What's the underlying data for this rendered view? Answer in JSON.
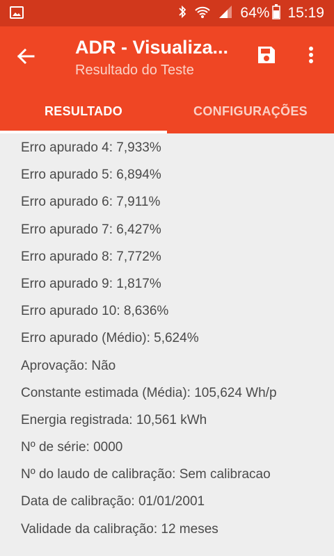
{
  "status_bar": {
    "battery_percent": "64%",
    "time": "15:19",
    "icons": [
      "image-icon",
      "bluetooth-icon",
      "wifi-icon",
      "signal-icon",
      "battery-icon"
    ]
  },
  "toolbar": {
    "title": "ADR - Visualiza...",
    "subtitle": "Resultado do Teste",
    "icons": [
      "back-arrow-icon",
      "save-icon",
      "more-vert-icon"
    ]
  },
  "tabs": [
    {
      "label": "RESULTADO",
      "active": true
    },
    {
      "label": "CONFIGURAÇÕES",
      "active": false
    }
  ],
  "results": [
    "Erro apurado 4: 7,933%",
    "Erro apurado 5: 6,894%",
    "Erro apurado 6: 7,911%",
    "Erro apurado 7: 6,427%",
    "Erro apurado 8: 7,772%",
    "Erro apurado 9: 1,817%",
    "Erro apurado 10: 8,636%",
    "Erro apurado (Médio): 5,624%",
    "Aprovação: Não",
    "Constante estimada (Média): 105,624 Wh/p",
    "Energia registrada: 10,561 kWh",
    "Nº de série: 0000",
    "Nº do laudo de calibração: Sem calibracao",
    "Data de calibração: 01/01/2001",
    "Validade da calibração: 12 meses"
  ],
  "colors": {
    "status_bar": "#d1381c",
    "toolbar": "#ef4624",
    "background": "#eeeeee",
    "text": "#4a4a4a"
  }
}
